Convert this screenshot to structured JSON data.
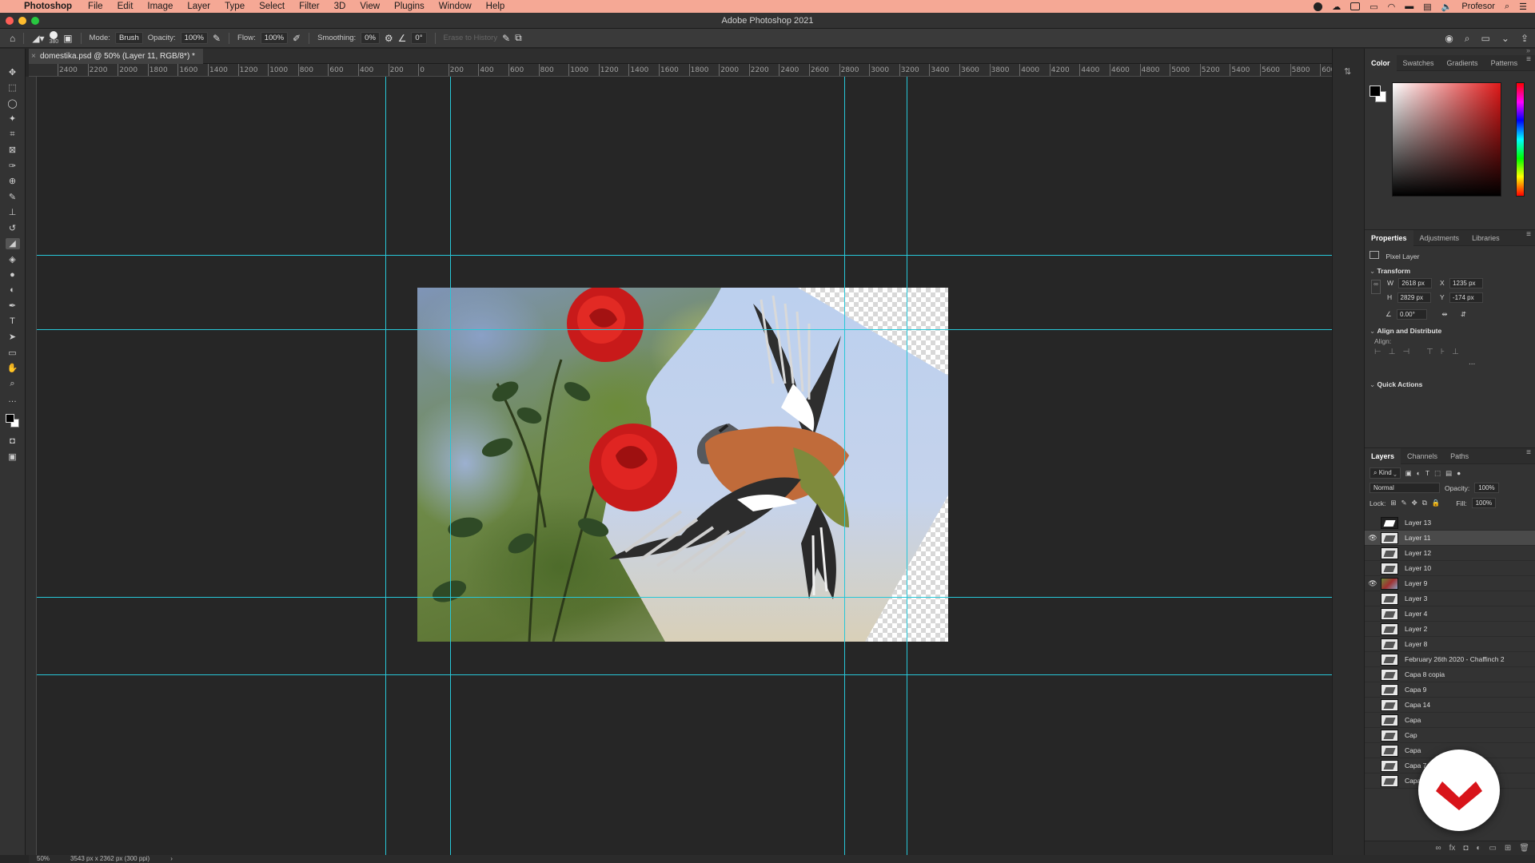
{
  "menubar": {
    "app_name": "Photoshop",
    "items": [
      "File",
      "Edit",
      "Image",
      "Layer",
      "Type",
      "Select",
      "Filter",
      "3D",
      "View",
      "Plugins",
      "Window",
      "Help"
    ],
    "user": "Profesor"
  },
  "window": {
    "title": "Adobe Photoshop 2021"
  },
  "options": {
    "brush_size": "380",
    "mode_label": "Mode:",
    "mode_value": "Brush",
    "opacity_label": "Opacity:",
    "opacity_value": "100%",
    "flow_label": "Flow:",
    "flow_value": "100%",
    "smoothing_label": "Smoothing:",
    "smoothing_value": "0%",
    "angle_value": "0°",
    "erase_history_label": "Erase to History"
  },
  "document": {
    "tab_label": "domestika.psd @ 50% (Layer 11, RGB/8*) *"
  },
  "ruler": {
    "h_ticks": [
      "2400",
      "2200",
      "2000",
      "1800",
      "1600",
      "1400",
      "1200",
      "1000",
      "800",
      "600",
      "400",
      "200",
      "0",
      "200",
      "400",
      "600",
      "800",
      "1000",
      "1200",
      "1400",
      "1600",
      "1800",
      "2000",
      "2200",
      "2400",
      "2600",
      "2800",
      "3000",
      "3200",
      "3400",
      "3600",
      "3800",
      "4000",
      "4200",
      "4400",
      "4600",
      "4800",
      "5000",
      "5200",
      "5400",
      "5600",
      "5800",
      "600"
    ]
  },
  "color_panel": {
    "tabs": [
      "Color",
      "Swatches",
      "Gradients",
      "Patterns"
    ]
  },
  "properties_panel": {
    "tabs": [
      "Properties",
      "Adjustments",
      "Libraries"
    ],
    "layer_type": "Pixel Layer",
    "transform_label": "Transform",
    "w_label": "W",
    "w_value": "2618 px",
    "h_label": "H",
    "h_value": "2829 px",
    "x_label": "X",
    "x_value": "1235 px",
    "y_label": "Y",
    "y_value": "-174 px",
    "angle_value": "0.00°",
    "align_section": "Align and Distribute",
    "align_label": "Align:",
    "more": "...",
    "quick_actions": "Quick Actions"
  },
  "layers_panel": {
    "tabs": [
      "Layers",
      "Channels",
      "Paths"
    ],
    "filter_label": "Kind",
    "blend_mode": "Normal",
    "opacity_label": "Opacity:",
    "opacity_value": "100%",
    "lock_label": "Lock:",
    "fill_label": "Fill:",
    "fill_value": "100%",
    "layers": [
      {
        "name": "Layer 13",
        "visible": false,
        "thumb": "dark"
      },
      {
        "name": "Layer 11",
        "visible": true,
        "thumb": "light",
        "selected": true
      },
      {
        "name": "Layer 12",
        "visible": false,
        "thumb": "light"
      },
      {
        "name": "Layer 10",
        "visible": false,
        "thumb": "light"
      },
      {
        "name": "Layer 9",
        "visible": true,
        "thumb": "photo"
      },
      {
        "name": "Layer 3",
        "visible": false,
        "thumb": "light"
      },
      {
        "name": "Layer 4",
        "visible": false,
        "thumb": "light"
      },
      {
        "name": "Layer 2",
        "visible": false,
        "thumb": "light"
      },
      {
        "name": "Layer 8",
        "visible": false,
        "thumb": "light"
      },
      {
        "name": "February 26th 2020 - Chaffinch 2",
        "visible": false,
        "thumb": "light"
      },
      {
        "name": "Capa 8 copia",
        "visible": false,
        "thumb": "light"
      },
      {
        "name": "Capa 9",
        "visible": false,
        "thumb": "light"
      },
      {
        "name": "Capa 14",
        "visible": false,
        "thumb": "light"
      },
      {
        "name": "Capa",
        "visible": false,
        "thumb": "light"
      },
      {
        "name": "Cap",
        "visible": false,
        "thumb": "light"
      },
      {
        "name": "Capa",
        "visible": false,
        "thumb": "light"
      },
      {
        "name": "Capa 7 copia",
        "visible": false,
        "thumb": "light"
      },
      {
        "name": "Capa 2 copia",
        "visible": false,
        "thumb": "light"
      }
    ]
  },
  "statusbar": {
    "zoom": "50%",
    "doc_info": "3543 px x 2362 px (300 ppi)",
    "arrow": "›"
  },
  "colors": {
    "guide": "#27c7d8",
    "menubar": "#f5a895",
    "badge_red": "#d8141a"
  }
}
